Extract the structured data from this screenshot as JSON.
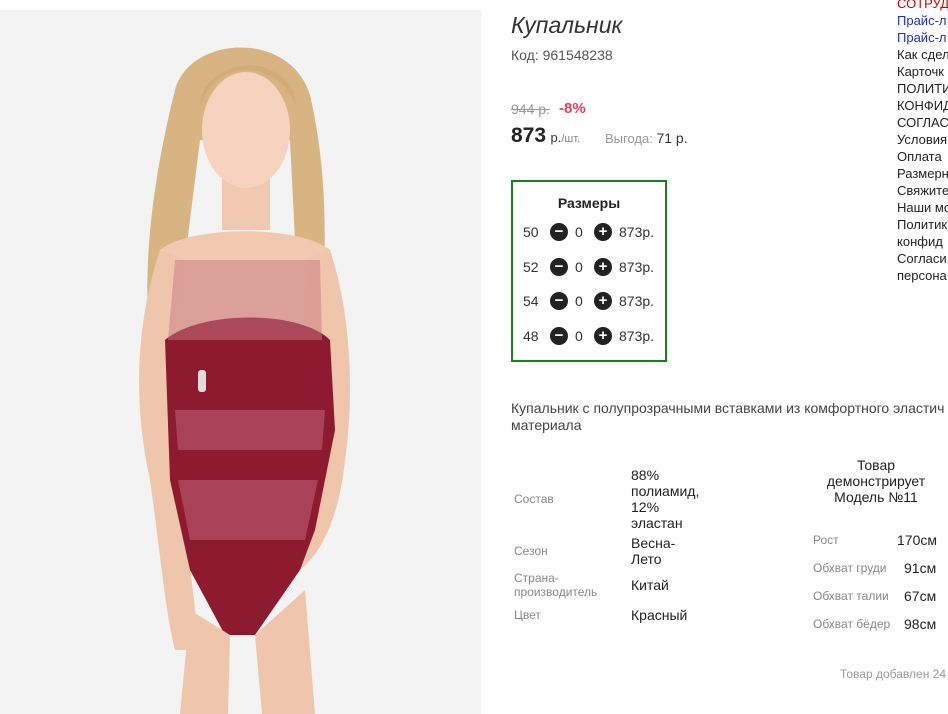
{
  "product": {
    "title": "Купальник",
    "code": "Код: 961548238",
    "old_price": "944 р.",
    "discount": "-8%",
    "price": "873",
    "price_unit": "р.",
    "price_per": "/шт.",
    "benefit_label": "Выгода:",
    "benefit_value": "71 р.",
    "description": "Купальник с полупрозрачными вставками из комфортного эластичного материала",
    "description_line1": "Купальник с полупрозрачными вставками из комфортного эластич",
    "description_line2": "материала",
    "added": "Товар добавлен 24"
  },
  "sizes": {
    "heading": "Размеры",
    "rows": [
      {
        "size": "50",
        "qty": "0",
        "price": "873р."
      },
      {
        "size": "52",
        "qty": "0",
        "price": "873р."
      },
      {
        "size": "54",
        "qty": "0",
        "price": "873р."
      },
      {
        "size": "48",
        "qty": "0",
        "price": "873р."
      }
    ]
  },
  "properties": [
    {
      "label": "Состав",
      "value": "88% полиамид, 12% эластан"
    },
    {
      "label": "Сезон",
      "value": "Весна-Лето"
    },
    {
      "label": "Страна-производитель",
      "value": "Китай"
    },
    {
      "label": "Цвет",
      "value": "Красный"
    }
  ],
  "model": {
    "heading": "Товар демонстрирует Модель №11",
    "params": [
      {
        "label": "Рост",
        "value": "170см"
      },
      {
        "label": "Обхват груди",
        "value": "91см"
      },
      {
        "label": "Обхват талии",
        "value": "67см"
      },
      {
        "label": "Обхват бёдер",
        "value": "98см"
      }
    ]
  },
  "sidebar": {
    "links": [
      {
        "text": "СОТРУД",
        "color": "red"
      },
      {
        "text": "Прайс-л",
        "color": "blue"
      },
      {
        "text": "Прайс-л",
        "color": "blue"
      },
      {
        "text": "Как сдел",
        "color": "black"
      },
      {
        "text": "Карточк",
        "color": "black"
      },
      {
        "text": "ПОЛИТИ",
        "color": "black"
      },
      {
        "text": "КОНФИД",
        "color": "black"
      },
      {
        "text": "СОГЛАС",
        "color": "black"
      },
      {
        "text": "Условия",
        "color": "black"
      },
      {
        "text": "Оплата",
        "color": "black"
      },
      {
        "text": "Размерн",
        "color": "black"
      },
      {
        "text": "Свяжите",
        "color": "black"
      },
      {
        "text": "Наши мо",
        "color": "black"
      },
      {
        "text": "Политик",
        "color": "black"
      },
      {
        "text": "конфид",
        "color": "black"
      },
      {
        "text": "Согласи",
        "color": "black"
      },
      {
        "text": "персона",
        "color": "black"
      }
    ]
  },
  "colors": {
    "accent_green": "#1c7d1c",
    "discount_red": "#e2405b",
    "swimsuit": "#8e1a30",
    "cart_button": "#a6d92b"
  }
}
